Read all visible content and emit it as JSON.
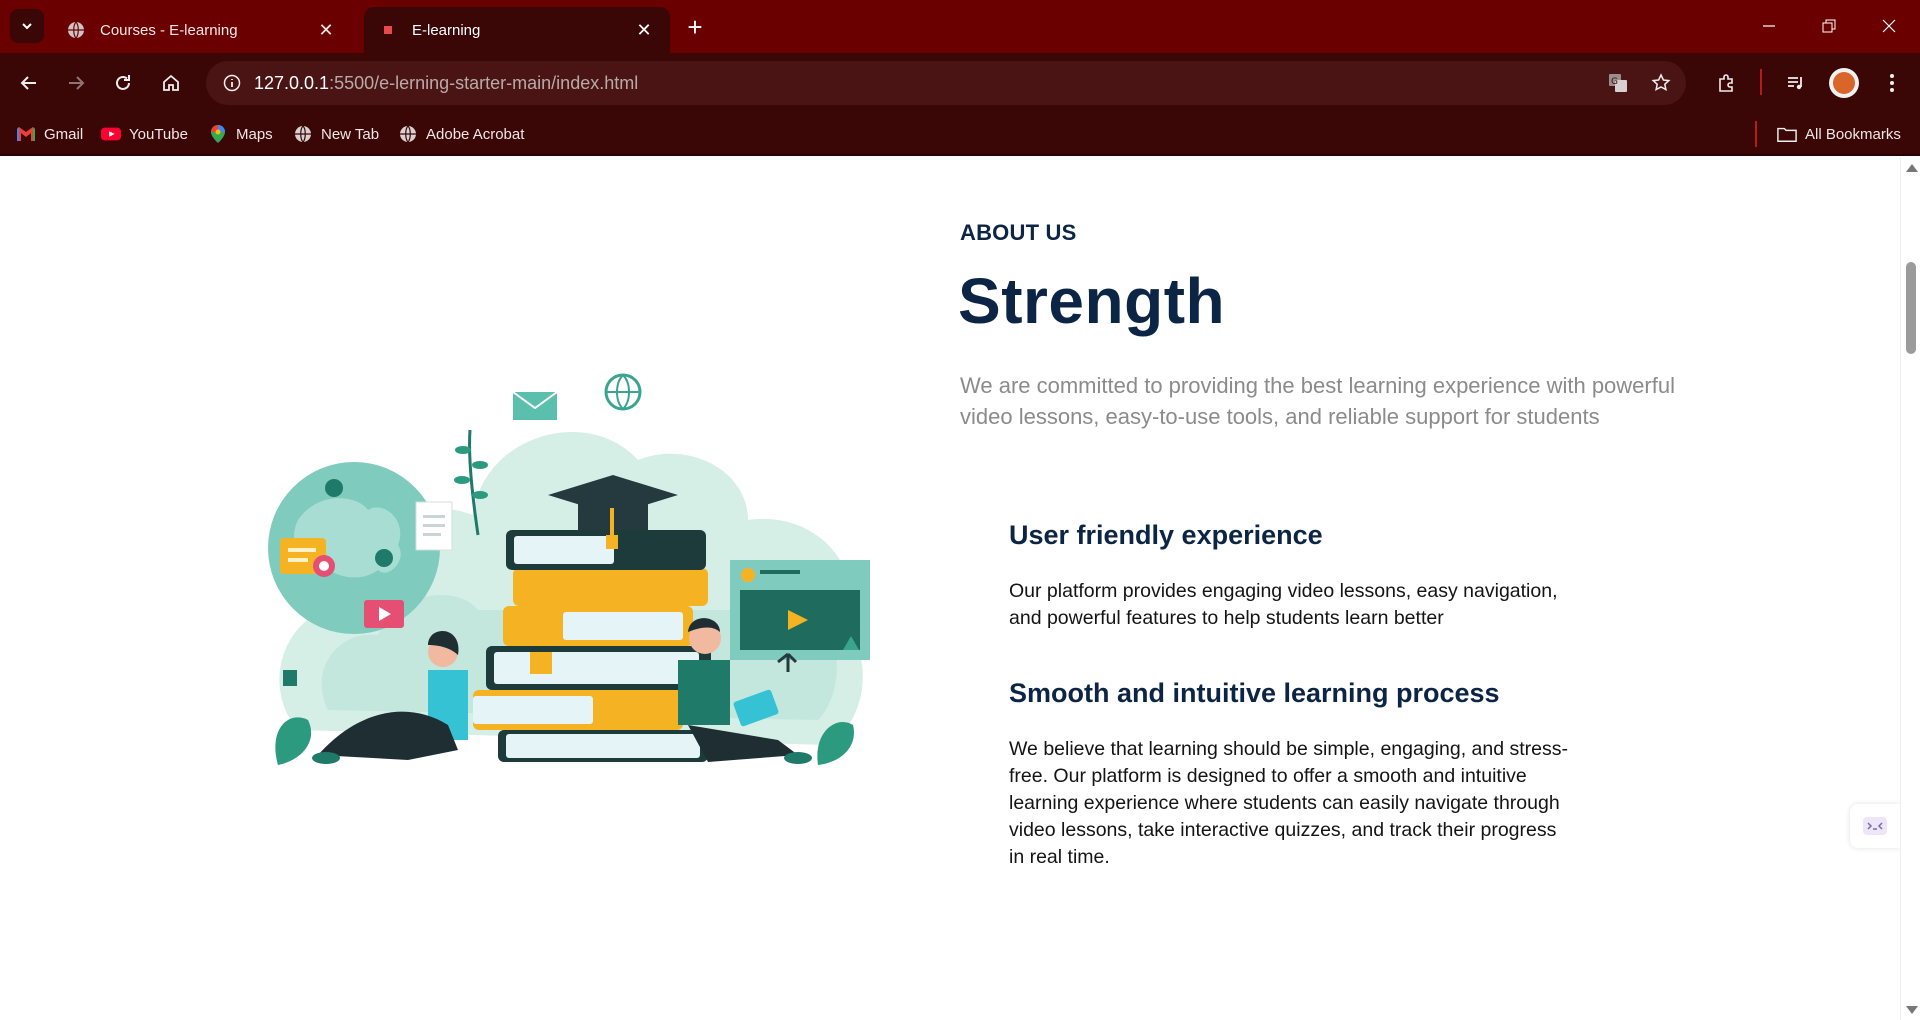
{
  "browser": {
    "tabs": [
      {
        "title": "Courses - E-learning",
        "active": false
      },
      {
        "title": "E-learning",
        "active": true
      }
    ],
    "url_host": "127.0.0.1",
    "url_path": ":5500/e-lerning-starter-main/index.html",
    "bookmarks": [
      "Gmail",
      "YouTube",
      "Maps",
      "New Tab",
      "Adobe Acrobat"
    ],
    "all_bookmarks_label": "All Bookmarks",
    "colors": {
      "frame": "#6b0000",
      "toolbar": "#3a0606"
    }
  },
  "about": {
    "eyebrow": "ABOUT US",
    "title": "Strength",
    "lead": "We are committed to providing the best learning experience with powerful video lessons, easy-to-use tools, and reliable support for students",
    "features": [
      {
        "title": "User friendly experience",
        "text": "Our platform provides engaging video lessons, easy navigation, and powerful features to help students learn better"
      },
      {
        "title": "Smooth and intuitive learning process",
        "text": "We believe that learning should be simple, engaging, and stress-free. Our platform is designed to offer a smooth and intuitive learning experience where students can easily navigate through video lessons, take interactive quizzes, and track their progress in real time."
      }
    ],
    "colors": {
      "heading": "#0c2545",
      "lead": "#8b8b8b",
      "accent_teal": "#1f7a6a",
      "accent_yellow": "#f5b324"
    }
  }
}
